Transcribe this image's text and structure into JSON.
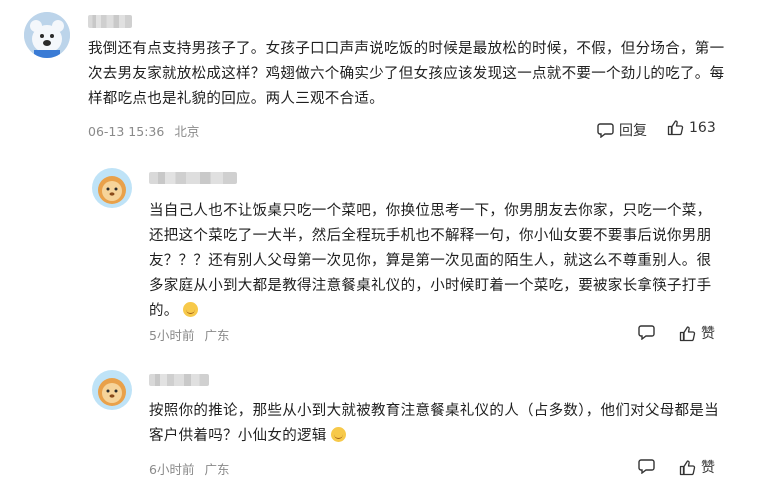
{
  "comments": [
    {
      "text": "我倒还有点支持男孩子了。女孩子口口声声说吃饭的时候是最放松的时候，不假，但分场合，第一次去男友家就放松成这样？鸡翅做六个确实少了但女孩应该发现这一点就不要一个劲儿的吃了。每样都吃点也是礼貌的回应。两人三观不合适。",
      "date": "06-13 15:36",
      "location": "北京",
      "reply_label": "回复",
      "like_count": "163"
    },
    {
      "text": "当自己人也不让饭桌只吃一个菜吧，你换位思考一下，你男朋友去你家，只吃一个菜，还把这个菜吃了一大半，然后全程玩手机也不解释一句，你小仙女要不要事后说你男朋友？？？还有别人父母第一次见你，算是第一次见面的陌生人，就这么不尊重别人。很多家庭从小到大都是教得注意餐桌礼仪的，小时候盯着一个菜吃，要被家长拿筷子打手的。",
      "date": "5小时前",
      "location": "广东",
      "reply_label": "",
      "like_label": "赞"
    },
    {
      "text": "按照你的推论，那些从小到大就被教育注意餐桌礼仪的人（占多数），他们对父母都是当客户供着吗？小仙女的逻辑",
      "date": "6小时前",
      "location": "广东",
      "reply_label": "",
      "like_label": "赞"
    }
  ],
  "icons": {
    "reply": "comment-bubble-icon",
    "like": "thumbs-up-icon",
    "emoji": "smile-emoji-icon"
  },
  "colors": {
    "text": "#1f1f1f",
    "meta": "#8a8a8a",
    "icon": "#333333"
  }
}
